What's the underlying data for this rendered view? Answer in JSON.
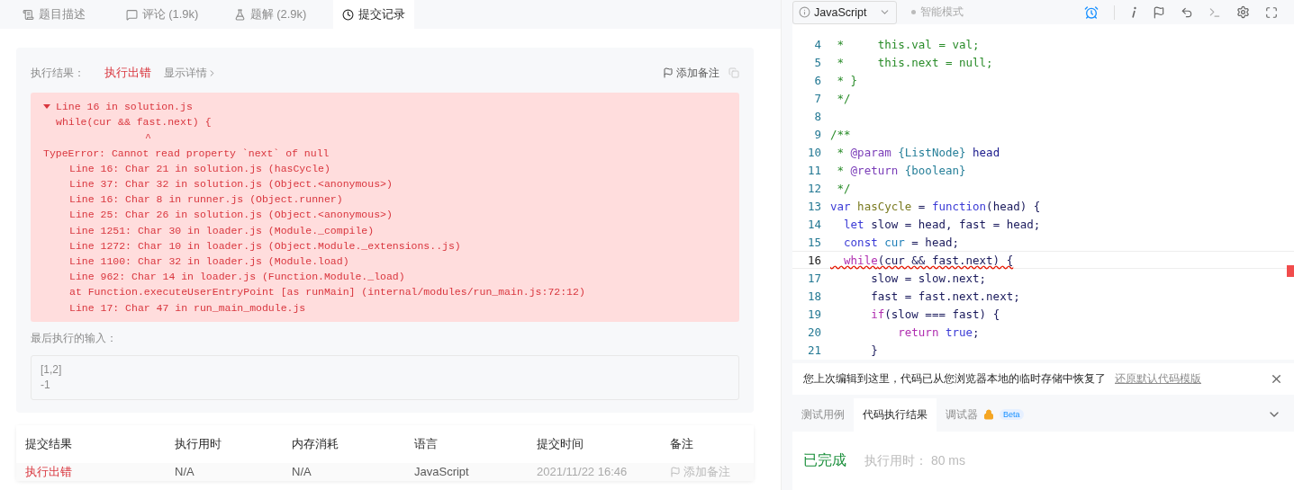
{
  "left_tabs": [
    {
      "label": "题目描述",
      "selected": false
    },
    {
      "label": "评论 (1.9k)",
      "selected": false
    },
    {
      "label": "题解 (2.9k)",
      "selected": false
    },
    {
      "label": "提交记录",
      "selected": true
    }
  ],
  "result": {
    "label": "执行结果：",
    "status": "执行出错",
    "details_link": "显示详情",
    "add_note": "添加备注",
    "error_lines": [
      {
        "kind": "head",
        "text": "Line 16 in solution.js"
      },
      {
        "kind": "code",
        "text": "while(cur && fast.next) {"
      },
      {
        "kind": "caret",
        "text": "^"
      },
      {
        "kind": "message",
        "text": "TypeError: Cannot read property `next` of null"
      },
      {
        "kind": "trace",
        "text": "Line 16: Char 21 in solution.js (hasCycle)"
      },
      {
        "kind": "trace",
        "text": "Line 37: Char 32 in solution.js (Object.<anonymous>)"
      },
      {
        "kind": "trace",
        "text": "Line 16: Char 8 in runner.js (Object.runner)"
      },
      {
        "kind": "trace",
        "text": "Line 25: Char 26 in solution.js (Object.<anonymous>)"
      },
      {
        "kind": "trace",
        "text": "Line 1251: Char 30 in loader.js (Module._compile)"
      },
      {
        "kind": "trace",
        "text": "Line 1272: Char 10 in loader.js (Object.Module._extensions..js)"
      },
      {
        "kind": "trace",
        "text": "Line 1100: Char 32 in loader.js (Module.load)"
      },
      {
        "kind": "trace",
        "text": "Line 962: Char 14 in loader.js (Function.Module._load)"
      },
      {
        "kind": "trace",
        "text": "at Function.executeUserEntryPoint [as runMain] (internal/modules/run_main.js:72:12)"
      },
      {
        "kind": "trace",
        "text": "Line 17: Char 47 in run_main_module.js"
      }
    ],
    "last_input_label": "最后执行的输入：",
    "last_input": [
      "[1,2]",
      "-1"
    ]
  },
  "table": {
    "columns": [
      "提交结果",
      "执行用时",
      "内存消耗",
      "语言",
      "提交时间",
      "备注"
    ],
    "rows": [
      {
        "status": "执行出错",
        "time": "N/A",
        "memory": "N/A",
        "language": "JavaScript",
        "submitted": "2021/11/22 16:46",
        "note": "添加备注"
      }
    ]
  },
  "editor": {
    "language": "JavaScript",
    "smart_mode": "智能模式",
    "lines": [
      {
        "number": "4",
        "error": false,
        "tokens": [
          {
            "kind": "comment",
            "text": " *     this.val = val;"
          }
        ]
      },
      {
        "number": "5",
        "error": false,
        "tokens": [
          {
            "kind": "comment",
            "text": " *     this.next = null;"
          }
        ]
      },
      {
        "number": "6",
        "error": false,
        "tokens": [
          {
            "kind": "comment",
            "text": " * }"
          }
        ]
      },
      {
        "number": "7",
        "error": false,
        "tokens": [
          {
            "kind": "comment",
            "text": " */"
          }
        ]
      },
      {
        "number": "8",
        "error": false
      },
      {
        "number": "9",
        "error": false,
        "tokens": [
          {
            "kind": "comment",
            "text": "/**"
          }
        ]
      },
      {
        "number": "10",
        "error": false,
        "tokens": [
          {
            "kind": "comment",
            "text": " * "
          },
          {
            "kind": "tag",
            "text": "@param"
          },
          {
            "kind": "type",
            "text": " {ListNode}"
          },
          {
            "kind": "name",
            "text": " head"
          }
        ]
      },
      {
        "number": "11",
        "error": false,
        "tokens": [
          {
            "kind": "comment",
            "text": " * "
          },
          {
            "kind": "tag",
            "text": "@return"
          },
          {
            "kind": "type",
            "text": " {boolean}"
          }
        ]
      },
      {
        "number": "12",
        "error": false,
        "tokens": [
          {
            "kind": "comment",
            "text": " */"
          }
        ]
      },
      {
        "number": "13",
        "error": false,
        "tokens": [
          {
            "kind": "keyword",
            "text": "var"
          },
          {
            "kind": "fn",
            "text": " hasCycle"
          },
          {
            "kind": "plain",
            "text": " = "
          },
          {
            "kind": "keyword",
            "text": "function"
          },
          {
            "kind": "plain",
            "text": "(head) {"
          }
        ]
      },
      {
        "number": "14",
        "error": false,
        "tokens": [
          {
            "kind": "keyword",
            "text": "  let"
          },
          {
            "kind": "plain",
            "text": " slow = head, fast = head;"
          }
        ]
      },
      {
        "number": "15",
        "error": false,
        "tokens": [
          {
            "kind": "keyword",
            "text": "  const"
          },
          {
            "kind": "var",
            "text": " cur"
          },
          {
            "kind": "plain",
            "text": " = head;"
          }
        ]
      },
      {
        "number": "16",
        "error": true,
        "tokens": [
          {
            "kind": "control",
            "text": "  while"
          },
          {
            "kind": "plain",
            "text": "(cur && fast.next) {"
          }
        ]
      },
      {
        "number": "17",
        "error": false,
        "tokens": [
          {
            "kind": "plain",
            "text": "      slow = slow.next;"
          }
        ]
      },
      {
        "number": "18",
        "error": false,
        "tokens": [
          {
            "kind": "plain",
            "text": "      fast = fast.next.next;"
          }
        ]
      },
      {
        "number": "19",
        "error": false,
        "tokens": [
          {
            "kind": "control",
            "text": "      if"
          },
          {
            "kind": "plain",
            "text": "(slow === fast) {"
          }
        ]
      },
      {
        "number": "20",
        "error": false,
        "tokens": [
          {
            "kind": "control",
            "text": "          return"
          },
          {
            "kind": "keyword",
            "text": " true"
          },
          {
            "kind": "plain",
            "text": ";"
          }
        ]
      },
      {
        "number": "21",
        "error": false,
        "tokens": [
          {
            "kind": "plain",
            "text": "      }"
          }
        ]
      }
    ],
    "notice": "您上次编辑到这里，代码已从您浏览器本地的临时存储中恢复了",
    "notice_link": "还原默认代码模版",
    "bottom_tabs": [
      {
        "label": "测试用例",
        "selected": false,
        "locked": false
      },
      {
        "label": "代码执行结果",
        "selected": true,
        "locked": false
      },
      {
        "label": "调试器",
        "selected": false,
        "locked": true,
        "badge": "Beta"
      }
    ],
    "run_status": "已完成",
    "run_time": "执行用时： 80 ms"
  }
}
